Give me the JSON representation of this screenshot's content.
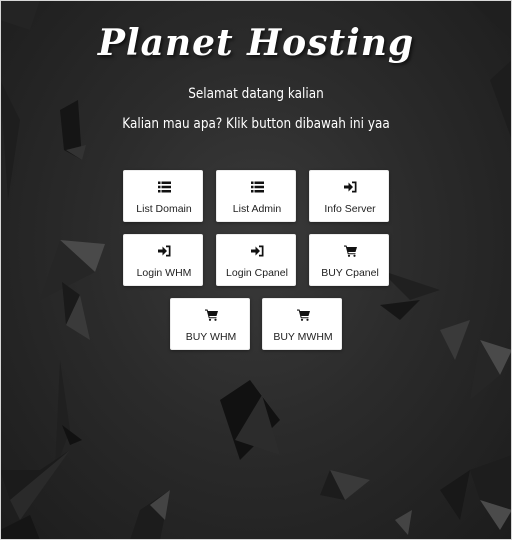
{
  "header": {
    "title": "Planet Hosting",
    "greeting": "Selamat datang kalian",
    "instruction": "Kalian mau apa? Klik button dibawah ini yaa"
  },
  "buttons": [
    {
      "label": "List Domain",
      "icon": "list-icon"
    },
    {
      "label": "List Admin",
      "icon": "list-icon"
    },
    {
      "label": "Info Server",
      "icon": "sign-in-icon"
    },
    {
      "label": "Login WHM",
      "icon": "sign-in-icon"
    },
    {
      "label": "Login Cpanel",
      "icon": "sign-in-icon"
    },
    {
      "label": "BUY Cpanel",
      "icon": "cart-icon"
    },
    {
      "label": "BUY WHM",
      "icon": "cart-icon"
    },
    {
      "label": "BUY MWHM",
      "icon": "cart-icon"
    }
  ],
  "colors": {
    "background": "#2b2b2b",
    "button_bg": "#ffffff",
    "text_light": "#ffffff",
    "text_dark": "#222222"
  }
}
